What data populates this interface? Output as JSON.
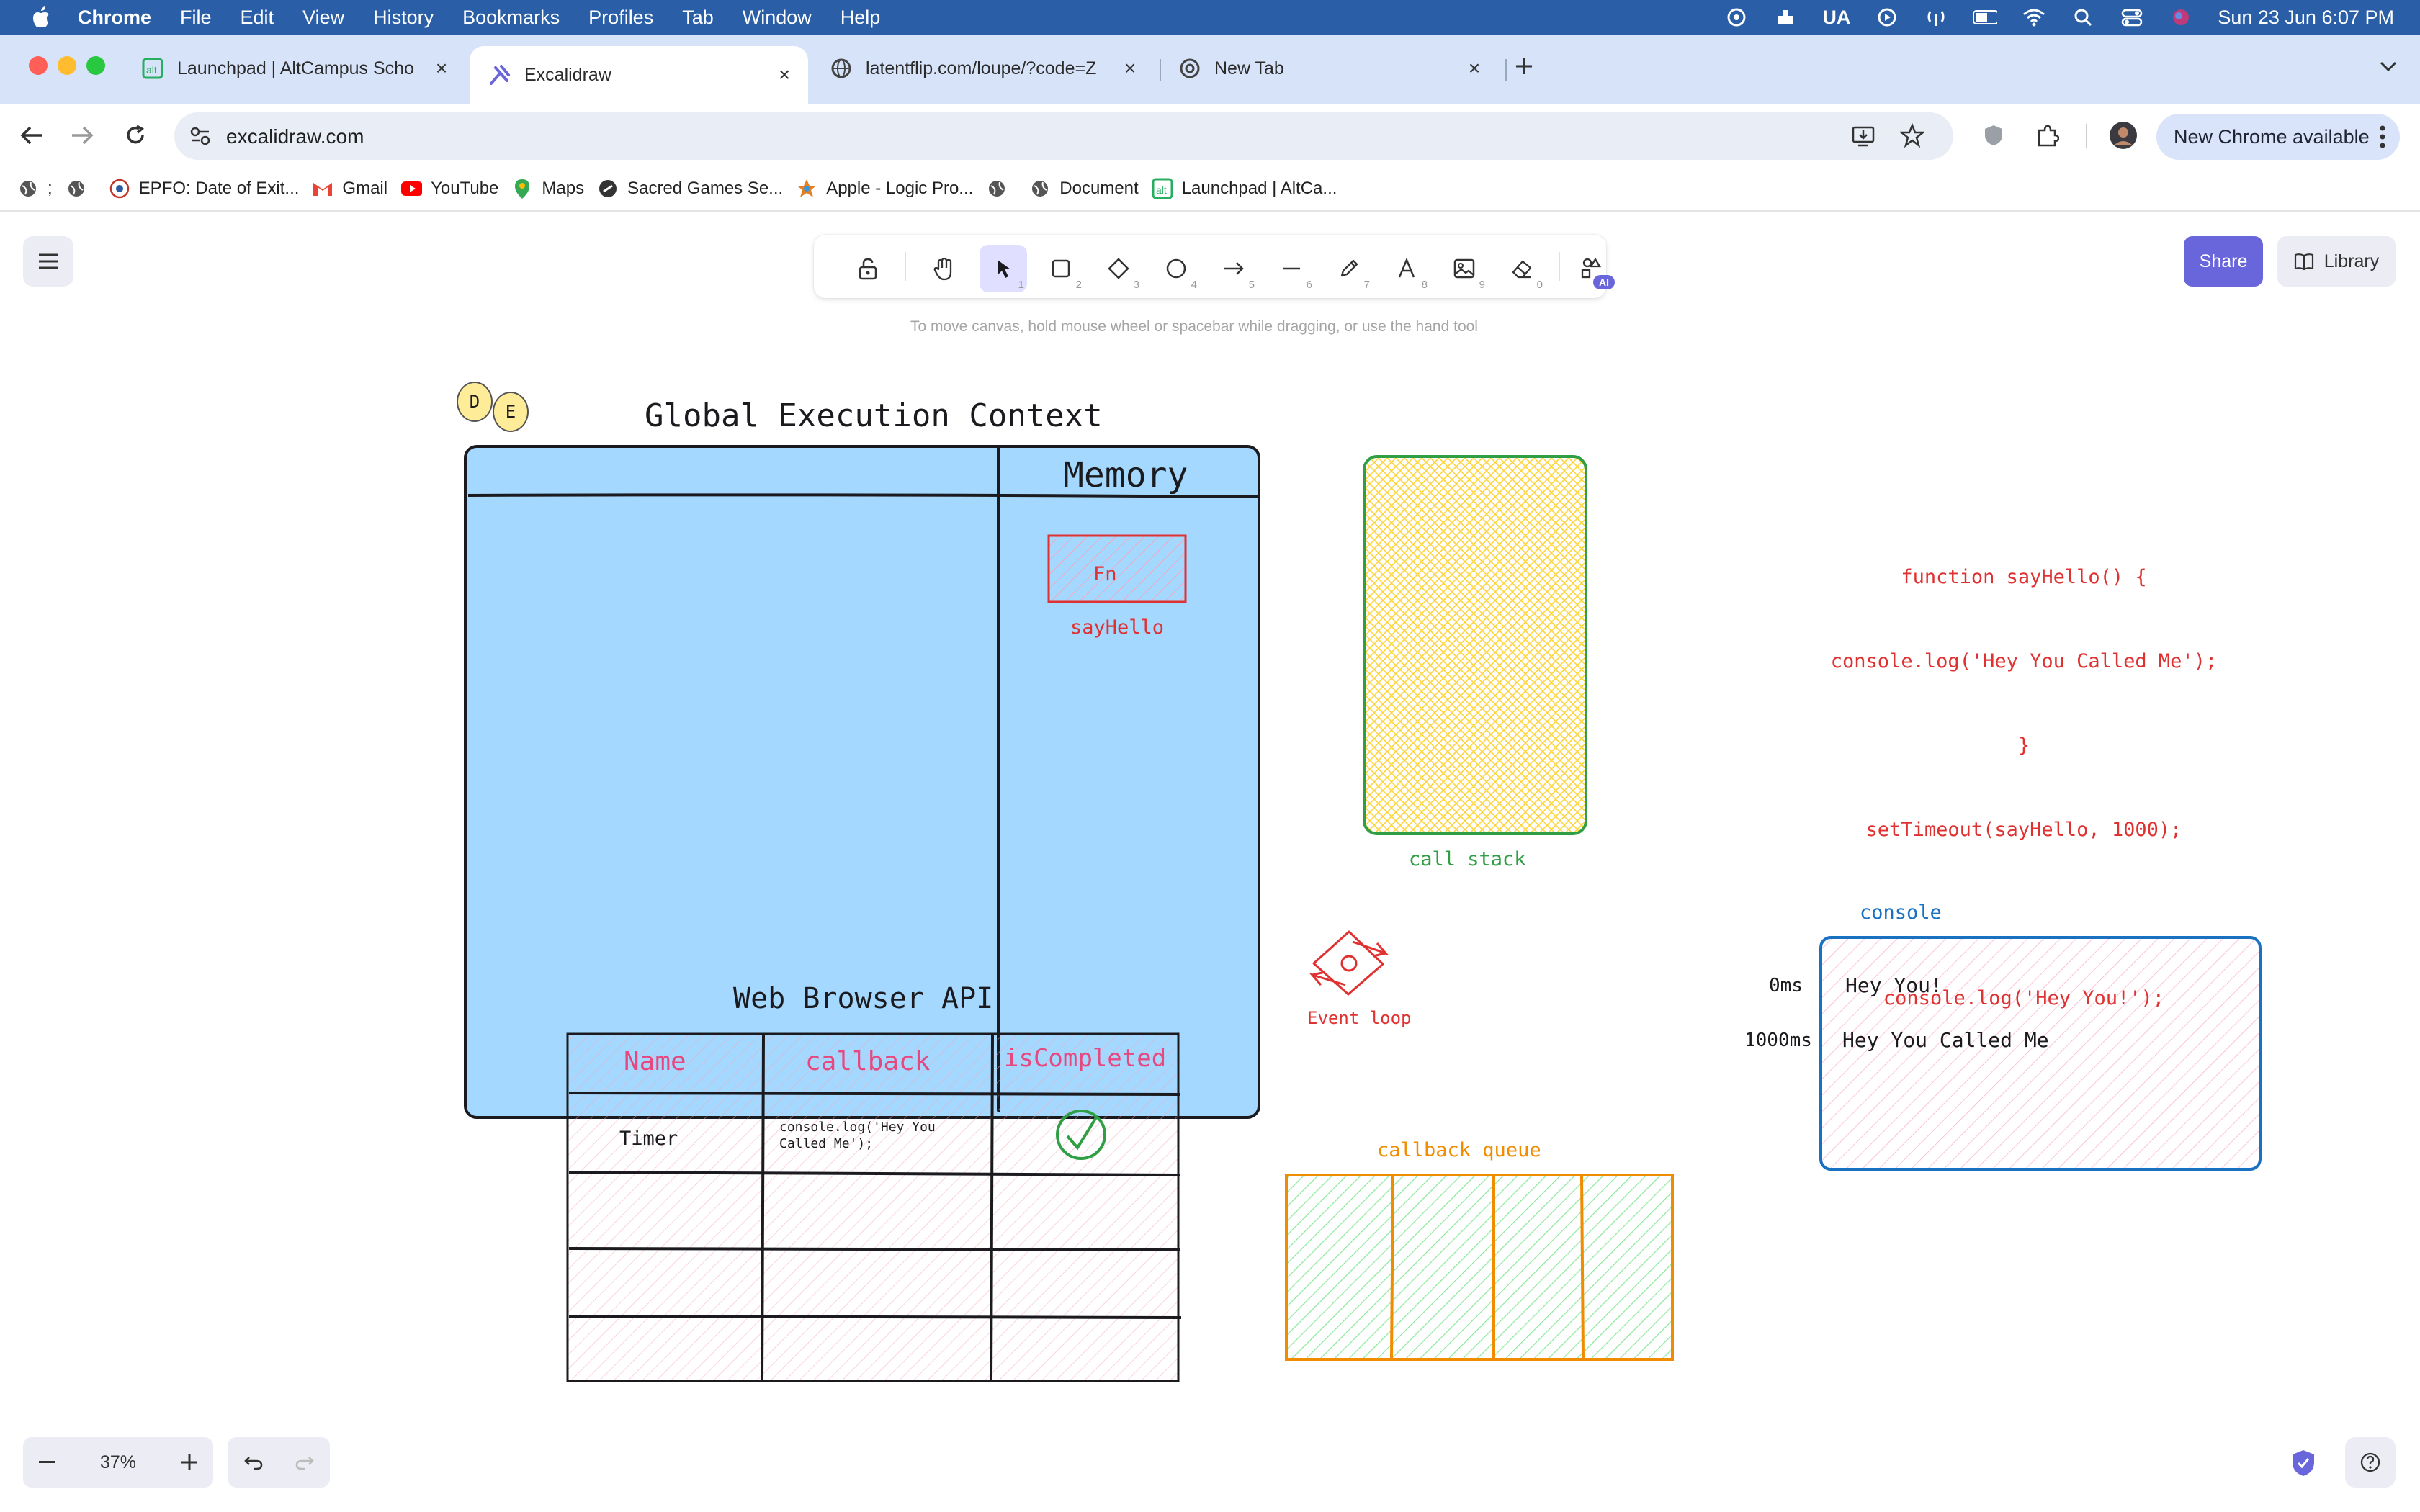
{
  "menubar": {
    "app_name": "Chrome",
    "items": [
      "File",
      "Edit",
      "View",
      "History",
      "Bookmarks",
      "Profiles",
      "Tab",
      "Window",
      "Help"
    ],
    "input_source": "UA",
    "datetime": "Sun 23 Jun  6:07 PM"
  },
  "tabs": [
    {
      "title": "Launchpad | AltCampus Scho",
      "icon": "altcampus-icon",
      "active": false
    },
    {
      "title": "Excalidraw",
      "icon": "excalidraw-icon",
      "active": true
    },
    {
      "title": "latentflip.com/loupe/?code=Z",
      "icon": "globe-icon",
      "active": false
    },
    {
      "title": "New Tab",
      "icon": "chrome-icon",
      "active": false
    }
  ],
  "address_bar": {
    "url": "excalidraw.com"
  },
  "new_chrome_label": "New Chrome available",
  "bookmarks": [
    {
      "label": ";",
      "icon": "globe-icon"
    },
    {
      "label": "",
      "icon": "globe-icon"
    },
    {
      "label": "EPFO: Date of Exit...",
      "icon": "epfo-icon"
    },
    {
      "label": "Gmail",
      "icon": "gmail-icon"
    },
    {
      "label": "YouTube",
      "icon": "youtube-icon"
    },
    {
      "label": "Maps",
      "icon": "maps-icon"
    },
    {
      "label": "Sacred Games Se...",
      "icon": "link-icon"
    },
    {
      "label": "Apple - Logic Pro...",
      "icon": "apple-logic-icon"
    },
    {
      "label": "",
      "icon": "globe-icon"
    },
    {
      "label": "Document",
      "icon": "globe-icon"
    },
    {
      "label": "Launchpad | AltCa...",
      "icon": "altcampus-icon"
    }
  ],
  "excalidraw": {
    "hint": "To move canvas, hold mouse wheel or spacebar while dragging, or use the hand tool",
    "share_label": "Share",
    "library_label": "Library",
    "zoom": "37%",
    "tools": [
      {
        "name": "lock",
        "key": ""
      },
      {
        "name": "hand",
        "key": ""
      },
      {
        "name": "selection",
        "key": "1"
      },
      {
        "name": "rectangle",
        "key": "2"
      },
      {
        "name": "diamond",
        "key": "3"
      },
      {
        "name": "ellipse",
        "key": "4"
      },
      {
        "name": "arrow",
        "key": "5"
      },
      {
        "name": "line",
        "key": "6"
      },
      {
        "name": "draw",
        "key": "7"
      },
      {
        "name": "text",
        "key": "8"
      },
      {
        "name": "image",
        "key": "9"
      },
      {
        "name": "eraser",
        "key": "0"
      },
      {
        "name": "more-tools",
        "key": ""
      }
    ],
    "ai_badge": "AI",
    "collaborators": [
      "D",
      "E"
    ]
  },
  "drawing": {
    "gec_title": "Global Execution Context",
    "memory_label": "Memory",
    "fn_label": "Fn",
    "fn_name": "sayHello",
    "call_stack_label": "call stack",
    "code_lines": [
      "function sayHello() {",
      "console.log('Hey You Called Me');",
      "}",
      "setTimeout(sayHello, 1000);",
      "",
      "console.log('Hey You!');"
    ],
    "event_loop_label": "Event loop",
    "console_label": "console",
    "console_rows": [
      {
        "time": "0ms",
        "text": "Hey You!"
      },
      {
        "time": "1000ms",
        "text": "Hey You Called Me"
      }
    ],
    "web_api_title": "Web Browser API",
    "web_api_headers": [
      "Name",
      "callback",
      "isCompleted"
    ],
    "web_api_row": {
      "name": "Timer",
      "callback": "console.log('Hey You Called Me');"
    },
    "callback_queue_label": "callback queue"
  },
  "colors": {
    "menubar": "#2a5fa8",
    "tabstrip": "#d7e3f8",
    "excalidraw_primary": "#6965db",
    "gec_fill": "#a5d8ff",
    "red": "#e03131",
    "green": "#2f9e44",
    "orange": "#f08c00",
    "blue": "#1971c2",
    "pink": "#e64980"
  }
}
